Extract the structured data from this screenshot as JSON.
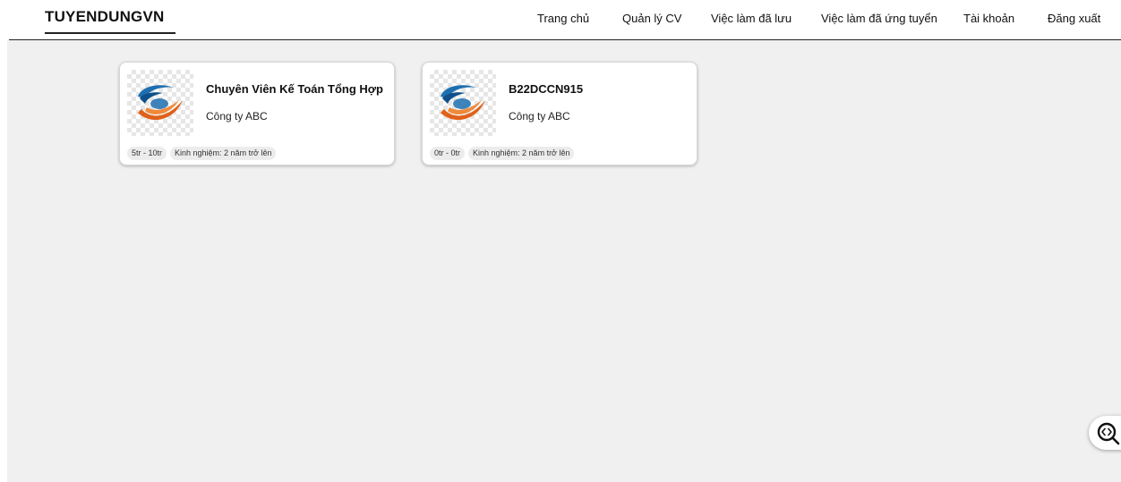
{
  "header": {
    "brand": "TUYENDUNGVN",
    "nav": {
      "home": "Trang chủ",
      "cv": "Quản lý CV",
      "saved": "Việc làm đã lưu",
      "applied": "Việc làm đã ứng tuyển",
      "account": "Tài khoản",
      "logout": "Đăng xuất"
    }
  },
  "jobs": [
    {
      "title": "Chuyên Viên Kế Toán Tổng Hợp",
      "company": "Công ty ABC",
      "salary": "5tr - 10tr",
      "experience": "Kinh nghiệm: 2 năm trở lên",
      "logo_icon": "company-logo-swoosh"
    },
    {
      "title": "B22DCCN915",
      "company": "Công ty ABC",
      "salary": "0tr - 0tr",
      "experience": "Kinh nghiệm: 2 năm trở lên",
      "logo_icon": "company-logo-swoosh"
    }
  ],
  "floating_button": {
    "icon": "zoom-code-icon"
  },
  "colors": {
    "background": "#f0f0f0",
    "card": "#ffffff",
    "logo_blue": "#1f6fb0",
    "logo_orange": "#e0611a"
  }
}
